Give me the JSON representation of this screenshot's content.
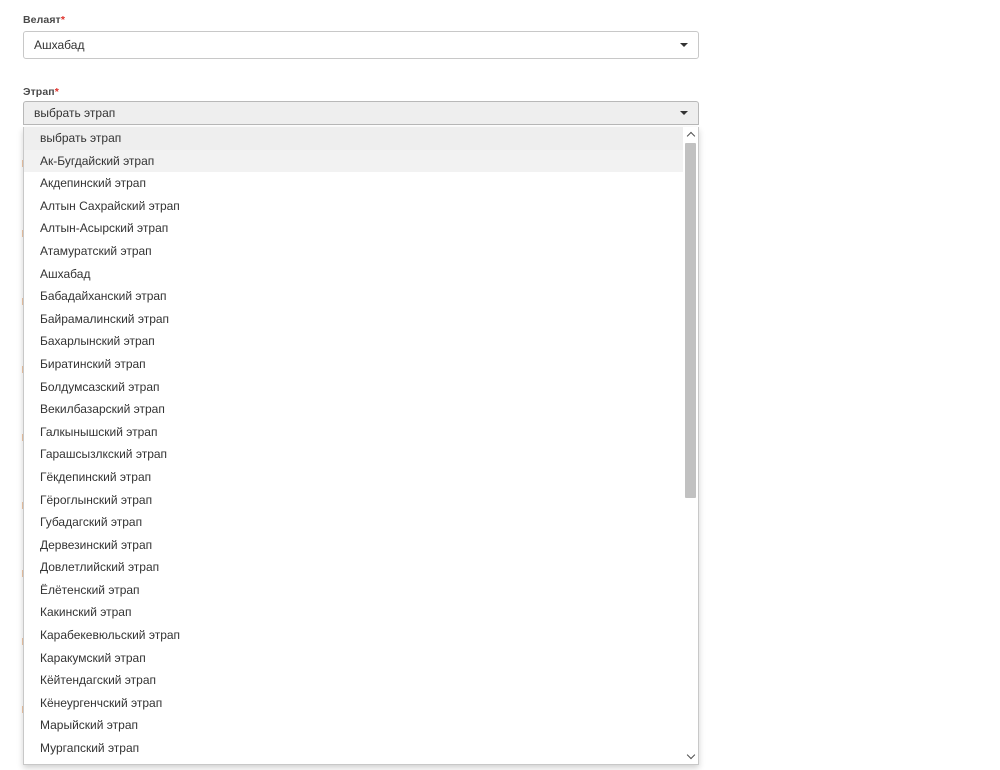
{
  "velayat": {
    "label": "Велаят",
    "required_mark": "*",
    "value": "Ашхабад"
  },
  "etrap": {
    "label": "Этрап",
    "required_mark": "*",
    "value": "выбрать этрап",
    "options": [
      "выбрать этрап",
      "Ак-Бугдайский этрап",
      "Акдепинский этрап",
      "Алтын Сахрайский этрап",
      "Алтын-Асырский этрап",
      "Атамуратский этрап",
      "Ашхабад",
      "Бабадайханский этрап",
      "Байрамалинский этрап",
      "Бахарлынский этрап",
      "Биратинский этрап",
      "Болдумсазский этрап",
      "Векилбазарский этрап",
      "Галкынышский этрап",
      "Гарашсызлкский этрап",
      "Гёкдепинский этрап",
      "Гёроглынский этрап",
      "Губадагский этрап",
      "Дервезинский этрап",
      "Довлетлийский этрап",
      "Ёлётенский этрап",
      "Какинский этрап",
      "Карабекевюльский этрап",
      "Каракумский этрап",
      "Кёйтендагский этрап",
      "Кёнеургенчский этрап",
      "Марыйский этрап",
      "Мургапский этрап"
    ],
    "selected_index": 0,
    "hovered_index": 1
  },
  "icons": {
    "caret": "caret-down-icon",
    "scroll_up": "chevron-up-icon",
    "scroll_down": "chevron-down-icon"
  }
}
